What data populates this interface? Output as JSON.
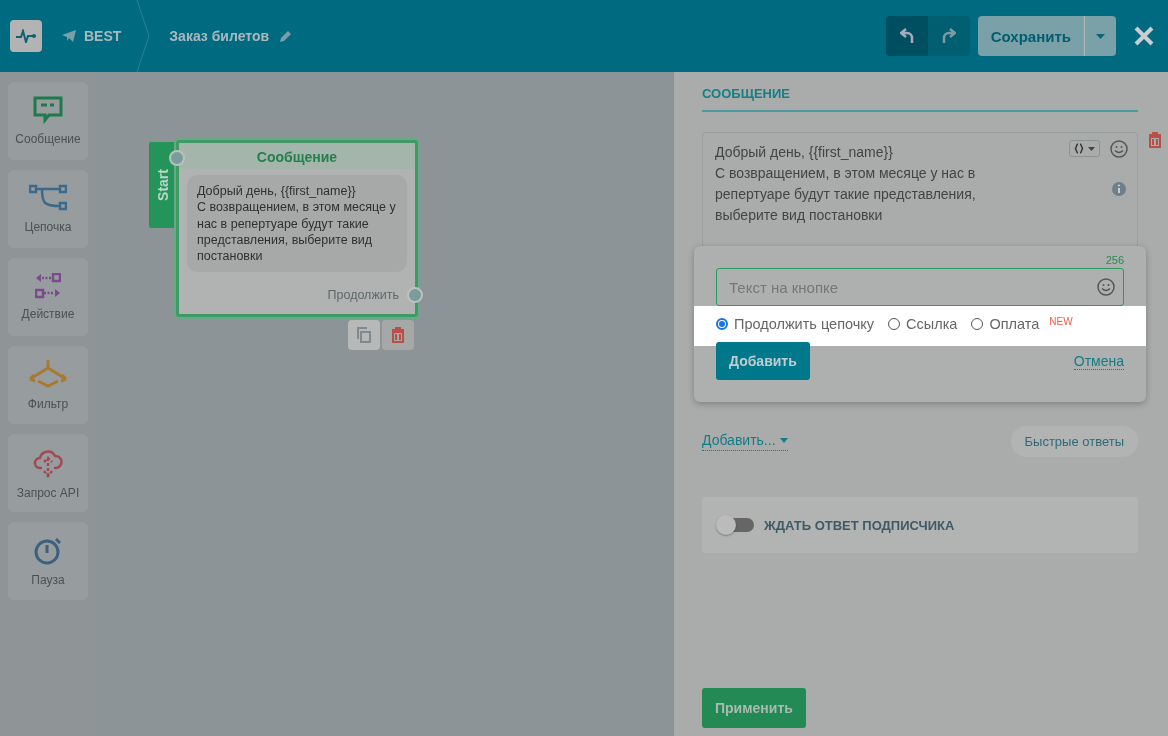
{
  "header": {
    "channel": "BEST",
    "flow_title": "Заказ билетов",
    "save": "Сохранить"
  },
  "toolbox": [
    {
      "kind": "message",
      "label": "Сообщение"
    },
    {
      "kind": "chain",
      "label": "Цепочка"
    },
    {
      "kind": "action",
      "label": "Действие"
    },
    {
      "kind": "filter",
      "label": "Фильтр"
    },
    {
      "kind": "api",
      "label": "Запрос API"
    },
    {
      "kind": "pause",
      "label": "Пауза"
    }
  ],
  "node": {
    "start_label": "Start",
    "title": "Сообщение",
    "text": "Добрый день,  {{first_name}}\nС возвращением, в этом месяце у нас в репертуаре будут такие представления, выберите вид постановки",
    "continue": "Продолжить"
  },
  "panel": {
    "section_title": "СООБЩЕНИЕ",
    "message": "Добрый день,  {{first_name}}\nС возвращением, в этом месяце у нас в\nрепертуаре будут такие представления,\nвыберите вид постановки",
    "counter": "256",
    "button_text": {
      "placeholder": "Текст на кнопке"
    },
    "options": [
      {
        "label": "Продолжить цепочку",
        "selected": true
      },
      {
        "label": "Ссылка",
        "selected": false
      },
      {
        "label": "Оплата",
        "selected": false,
        "badge": "NEW"
      }
    ],
    "add_button": "Добавить",
    "cancel": "Отмена",
    "add_menu": "Добавить...",
    "quick_replies": "Быстрые ответы",
    "wait_toggle": {
      "label": "ЖДАТЬ ОТВЕТ ПОДПИСЧИКА",
      "on": false
    },
    "apply": "Применить"
  }
}
